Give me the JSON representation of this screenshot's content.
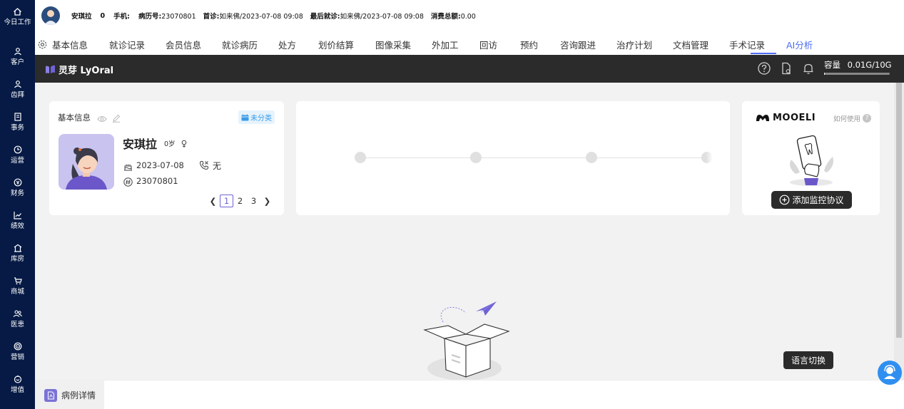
{
  "nav": {
    "items": [
      {
        "label": "今日工作",
        "icon": "home-icon"
      },
      {
        "label": "客户",
        "icon": "user-icon"
      },
      {
        "label": "齿拜",
        "icon": "user-icon"
      },
      {
        "label": "事务",
        "icon": "task-icon"
      },
      {
        "label": "运营",
        "icon": "clock-icon"
      },
      {
        "label": "财务",
        "icon": "money-icon"
      },
      {
        "label": "绩效",
        "icon": "chart-icon"
      },
      {
        "label": "库房",
        "icon": "warehouse-icon"
      },
      {
        "label": "商城",
        "icon": "cart-icon"
      },
      {
        "label": "医患",
        "icon": "people-icon"
      },
      {
        "label": "营销",
        "icon": "target-icon"
      },
      {
        "label": "增值",
        "icon": "gift-icon"
      }
    ]
  },
  "patient_bar": {
    "name": "安琪拉",
    "age": "0",
    "phone_label": "手机:",
    "record_label": "病历号:",
    "record_no": "23070801",
    "first_visit_label": "首诊:",
    "first_visit": "如来佛/2023-07-08 09:08",
    "last_visit_label": "最后就诊:",
    "last_visit": "如来佛/2023-07-08 09:08",
    "spend_label": "消费总额:",
    "spend": "0.00"
  },
  "tabs": [
    {
      "label": "基本信息"
    },
    {
      "label": "就诊记录"
    },
    {
      "label": "会员信息"
    },
    {
      "label": "就诊病历"
    },
    {
      "label": "处方"
    },
    {
      "label": "划价结算"
    },
    {
      "label": "图像采集"
    },
    {
      "label": "外加工"
    },
    {
      "label": "回访"
    },
    {
      "label": "预约"
    },
    {
      "label": "咨询跟进"
    },
    {
      "label": "治疗计划"
    },
    {
      "label": "文档管理"
    },
    {
      "label": "手术记录"
    },
    {
      "label": "AI分析",
      "active": true
    }
  ],
  "ai_header": {
    "brand": "灵芽 LyOral",
    "capacity_label": "容量",
    "capacity_value": "0.01G/10G",
    "capacity_used_fraction": 0.001
  },
  "info_card": {
    "title": "基本信息",
    "badge": "未分类",
    "name": "安琪拉",
    "age": "0岁",
    "dob": "2023-07-08",
    "phone": "无",
    "record_no": "23070801",
    "pages": [
      "1",
      "2",
      "3"
    ],
    "current_page": "1"
  },
  "mooeli": {
    "logo": "MOOELI",
    "how_to": "如何使用",
    "add_button": "添加监控协议"
  },
  "lang_button": "语言切换",
  "bottom": {
    "case_tab": "病例详情"
  },
  "colors": {
    "nav_bg": "#061a45",
    "accent": "#4b6cf5",
    "brand_purple": "#6e63d6",
    "header_dark": "#2b2b2b"
  }
}
